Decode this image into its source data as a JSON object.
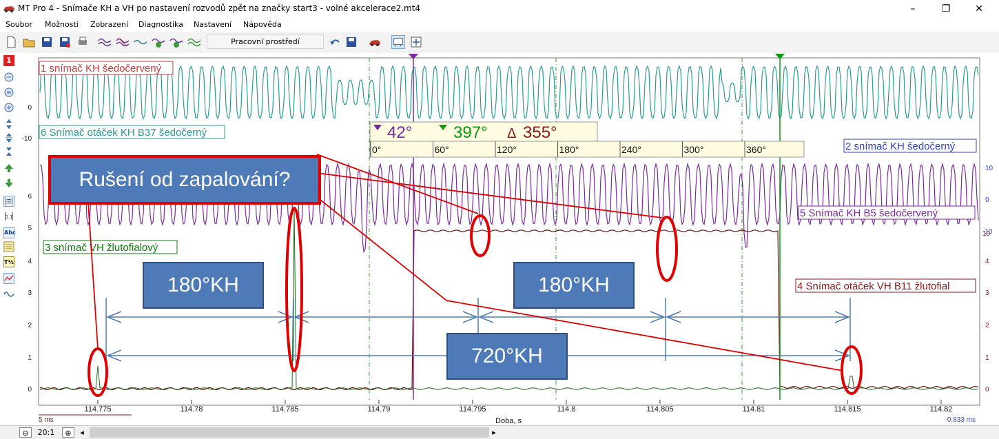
{
  "window": {
    "title": "MT Pro 4 - Snímače KH a VH po nastavení rozvodů zpět na značky start3 - volné akcelerace2.mt4",
    "minimize": "–",
    "maximize": "❐",
    "close": "✕"
  },
  "menu": [
    "Soubor",
    "Možnosti",
    "Zobrazení",
    "Diagnostika",
    "Nastavení",
    "Nápověda"
  ],
  "toolbar": {
    "workspace_label": "Pracovní prostředí"
  },
  "left_tools": {
    "channel_badge": "1",
    "text_label": "Abc",
    "ok_label": "T½"
  },
  "channels": {
    "ch1": "1 snímač KH šedočervený",
    "ch2": "2 snímač KH šedočerný",
    "ch3": "3 snímač VH žlutofialový",
    "ch4": "4 Snímač otáček VH B11 žlutofial",
    "ch5": "5 Snímač KH B5 šedočervený",
    "ch6": "6 Snímač otáček KH B37 šedočerný"
  },
  "left_axis_labels": [
    "0",
    "-10",
    "6",
    "5",
    "4",
    "3",
    "2",
    "1",
    "0"
  ],
  "right_axis_labels_ch2": [
    "10",
    "0",
    "-10"
  ],
  "right_axis_labels_ch4": [
    "5",
    "4",
    "3",
    "2",
    "1",
    "0"
  ],
  "right_axis_top5": "10",
  "cursor_readout": {
    "c1_label": "1",
    "c1_value": "42°",
    "c2_label": "2",
    "c2_value": "397°",
    "delta_label": "Δ",
    "delta_value": "355°",
    "angle_ticks": [
      "0°",
      "60°",
      "120°",
      "180°",
      "240°",
      "300°",
      "360°"
    ]
  },
  "x_axis": {
    "ticks": [
      "114.775",
      "114.78",
      "114.785",
      "114.79",
      "114.795",
      "114.8",
      "114.805",
      "114.81",
      "114.815",
      "114.82"
    ],
    "label": "Doba, s",
    "scale_left": "5 ms",
    "scale_right": "0.833 ms"
  },
  "annotations": {
    "interference": "Rušení od zapalování?",
    "half_left": "180°KH",
    "half_right": "180°KH",
    "full": "720°KH"
  },
  "status": {
    "zoom": "20:1"
  },
  "colors": {
    "teal": "#2a9a96",
    "purple": "#7b2a9e",
    "green": "#0e7a0e",
    "darkred": "#8a1a1a",
    "callout": "#4e7bb8",
    "highlight": "#e00000"
  }
}
